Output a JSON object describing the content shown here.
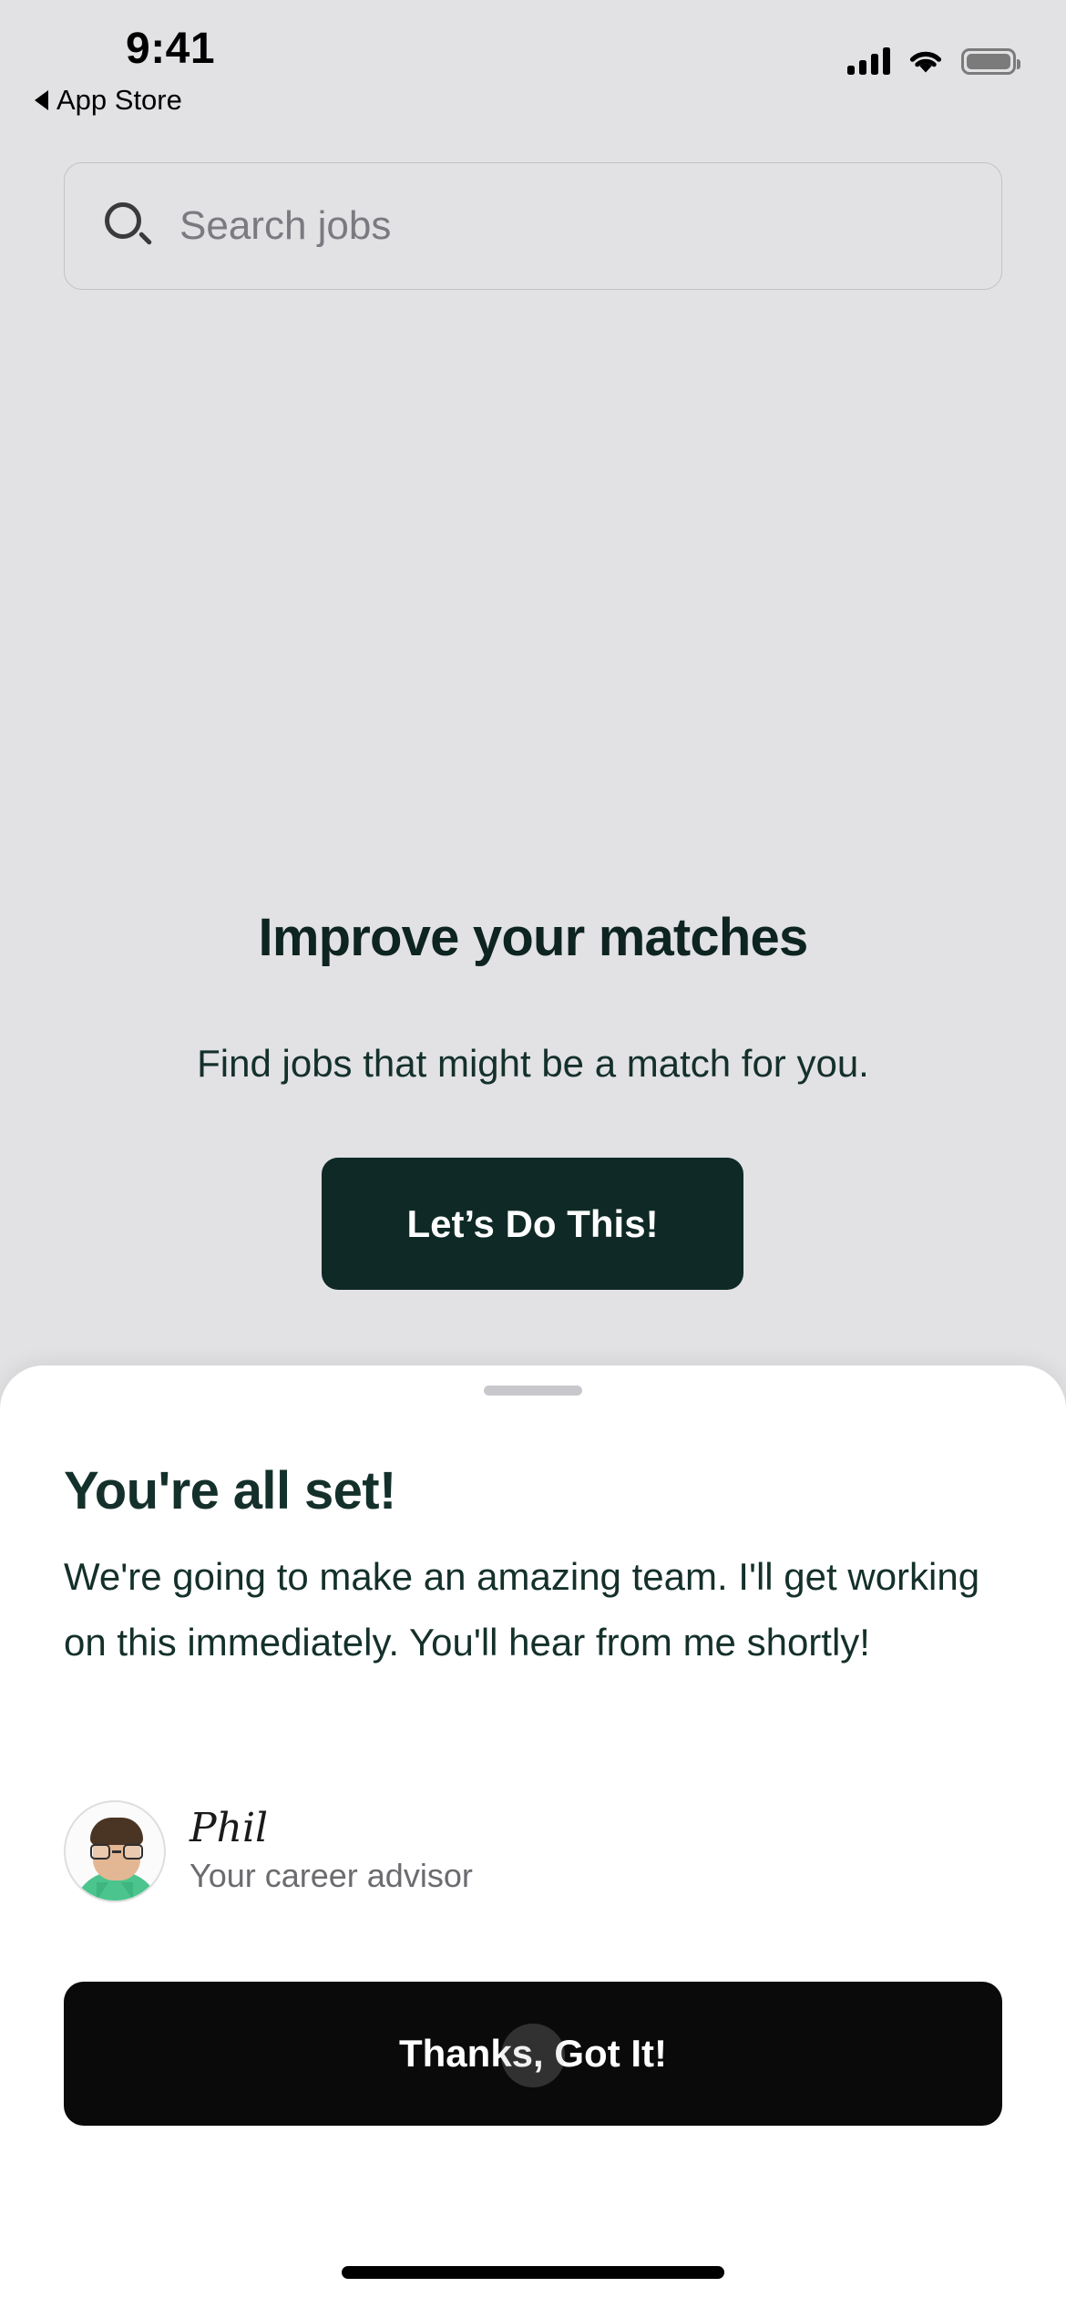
{
  "status_bar": {
    "time": "9:41",
    "cellular_icon": "cellular-signal-icon",
    "wifi_icon": "wifi-icon",
    "battery_icon": "battery-full-icon"
  },
  "back_link": {
    "label": "App Store",
    "caret_icon": "back-caret-icon"
  },
  "search": {
    "placeholder": "Search jobs",
    "value": "",
    "icon": "search-icon"
  },
  "hero": {
    "title": "Improve your matches",
    "subtitle": "Find jobs that might be a match for you.",
    "cta_label": "Let’s Do This!"
  },
  "sheet": {
    "handle": "drag-handle",
    "title": "You're all set!",
    "body": "We're going to make an amazing team. I'll get working on this immediately. You'll hear from me shortly!",
    "advisor": {
      "name": "Phil",
      "role": "Your career advisor",
      "avatar_icon": "advisor-avatar"
    },
    "dismiss_label": "Thanks, Got It!"
  },
  "colors": {
    "background": "#e2e1e4",
    "sheet_background": "#ffffff",
    "brand_dark_green": "#0f2a26",
    "heading_green": "#14302b",
    "dismiss_black": "#0a0a0a",
    "muted_text": "#6b6b70",
    "placeholder_text": "#7a7a80",
    "handle_gray": "#c8c8cc"
  }
}
